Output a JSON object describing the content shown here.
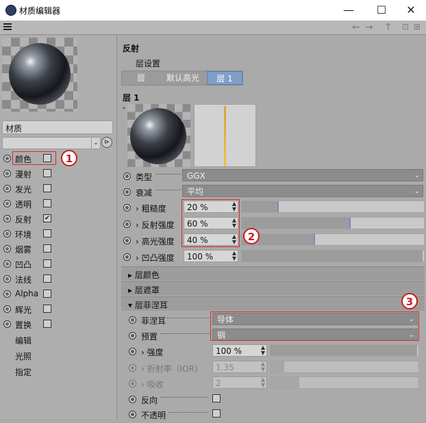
{
  "window": {
    "title": "材质编辑器",
    "minimize": "—",
    "maximize": "☐",
    "close": "✕"
  },
  "toolbar": {
    "back": "←",
    "forward": "→",
    "up": "↑"
  },
  "left": {
    "material_name": "材质",
    "channels": [
      {
        "label": "颜色",
        "checked": false
      },
      {
        "label": "漫射",
        "checked": false
      },
      {
        "label": "发光",
        "checked": false
      },
      {
        "label": "透明",
        "checked": false
      },
      {
        "label": "反射",
        "checked": true
      },
      {
        "label": "环境",
        "checked": false
      },
      {
        "label": "烟雾",
        "checked": false
      },
      {
        "label": "凹凸",
        "checked": false
      },
      {
        "label": "法线",
        "checked": false
      },
      {
        "label": "Alpha",
        "checked": false
      },
      {
        "label": "辉光",
        "checked": false
      },
      {
        "label": "置换",
        "checked": false
      }
    ],
    "extra": [
      "编辑",
      "光照",
      "指定"
    ]
  },
  "right": {
    "section_title": "反射",
    "layer_settings": "层设置",
    "tabs": [
      "层",
      "默认高光",
      "层 1"
    ],
    "layer_title": "层 1",
    "type": {
      "label": "类型",
      "value": "GGX"
    },
    "falloff": {
      "label": "衰减",
      "value": "平均"
    },
    "roughness": {
      "label": "粗糙度",
      "value": "20 %",
      "level": 0.2
    },
    "refl_strength": {
      "label": "反射强度",
      "value": "60 %",
      "level": 0.6
    },
    "spec_strength": {
      "label": "高光强度",
      "value": "40 %",
      "level": 0.4
    },
    "bump_strength": {
      "label": "凹凸强度",
      "value": "100 %",
      "level": 1.0
    },
    "groups": [
      "层颜色",
      "层遮罩",
      "层菲涅耳"
    ],
    "fresnel": {
      "label": "菲涅耳",
      "value": "导体"
    },
    "preset": {
      "label": "预置",
      "value": "钢"
    },
    "strength": {
      "label": "强度",
      "value": "100 %",
      "level": 1.0
    },
    "ior": {
      "label": "折射率（IOR)",
      "value": "1.35"
    },
    "absorb": {
      "label": "吸收",
      "value": "2"
    },
    "invert": {
      "label": "反向"
    },
    "opaque": {
      "label": "不透明"
    }
  },
  "callouts": [
    "1",
    "2",
    "3"
  ],
  "colors": {
    "highlight_red": "#d62b2b",
    "accent_blue": "#7f9fc8"
  }
}
